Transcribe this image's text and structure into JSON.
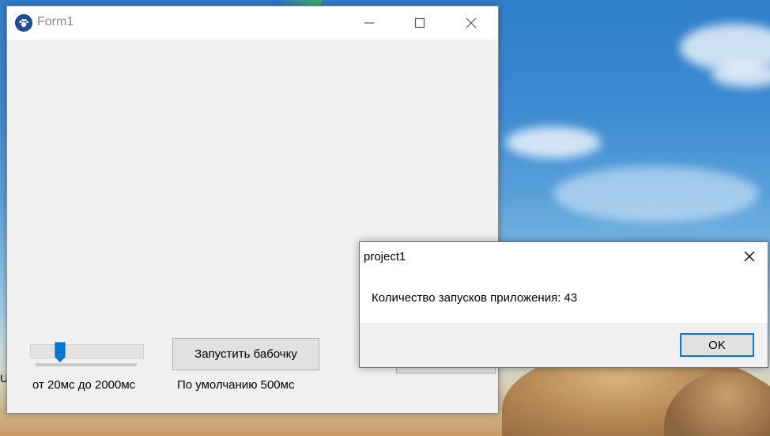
{
  "desktop": {
    "edge_glyph": "U"
  },
  "form1": {
    "title": "Form1",
    "icons": {
      "app": "paw-icon",
      "minimize": "minimize-icon",
      "maximize": "maximize-icon",
      "close": "close-icon"
    },
    "trackbar": {
      "min_ms": 20,
      "max_ms": 2000,
      "value_ms": 500
    },
    "range_label": "от 20мс до 2000мс",
    "start_button_label": "Запустить бабочку",
    "default_label": "По умолчанию 500мс"
  },
  "dialog": {
    "title": "project1",
    "message": "Количество запусков приложения: 43",
    "ok_label": "OK",
    "close_icon": "close-icon"
  },
  "colors": {
    "accent": "#0078d7",
    "window_bg": "#f0f0f0",
    "title_text": "#8a8a8a"
  }
}
